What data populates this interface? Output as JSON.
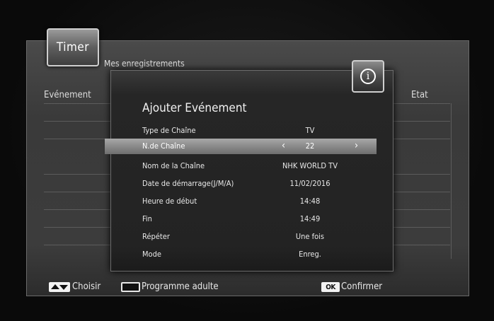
{
  "window": {
    "tab_title": "Timer",
    "subtitle": "Mes enregistrements",
    "col_event": "Evénement",
    "col_state": "Etat"
  },
  "dialog": {
    "title": "Ajouter Evénement",
    "rows": [
      {
        "label": "Type de Chaîne",
        "value": "TV"
      },
      {
        "label": "N.de Chaîne",
        "value": "22",
        "selected": true
      },
      {
        "label": "Nom de la Chaîne",
        "value": "NHK WORLD TV"
      },
      {
        "label": "Date de démarrage(J/M/A)",
        "value": "11/02/2016"
      },
      {
        "label": "Heure de début",
        "value": "14:48"
      },
      {
        "label": "Fin",
        "value": "14:49"
      },
      {
        "label": "Répéter",
        "value": "Une fois"
      },
      {
        "label": "Mode",
        "value": "Enreg."
      }
    ],
    "arrow_left": "‹",
    "arrow_right": "›"
  },
  "footer": {
    "choose": "Choisir",
    "adult": "Programme adulte",
    "ok_key": "OK",
    "confirm": "Confirmer"
  },
  "icons": {
    "info": "info-icon",
    "updown": "up-down-key-icon",
    "blank": "blank-key-icon",
    "ok": "ok-key-icon"
  }
}
